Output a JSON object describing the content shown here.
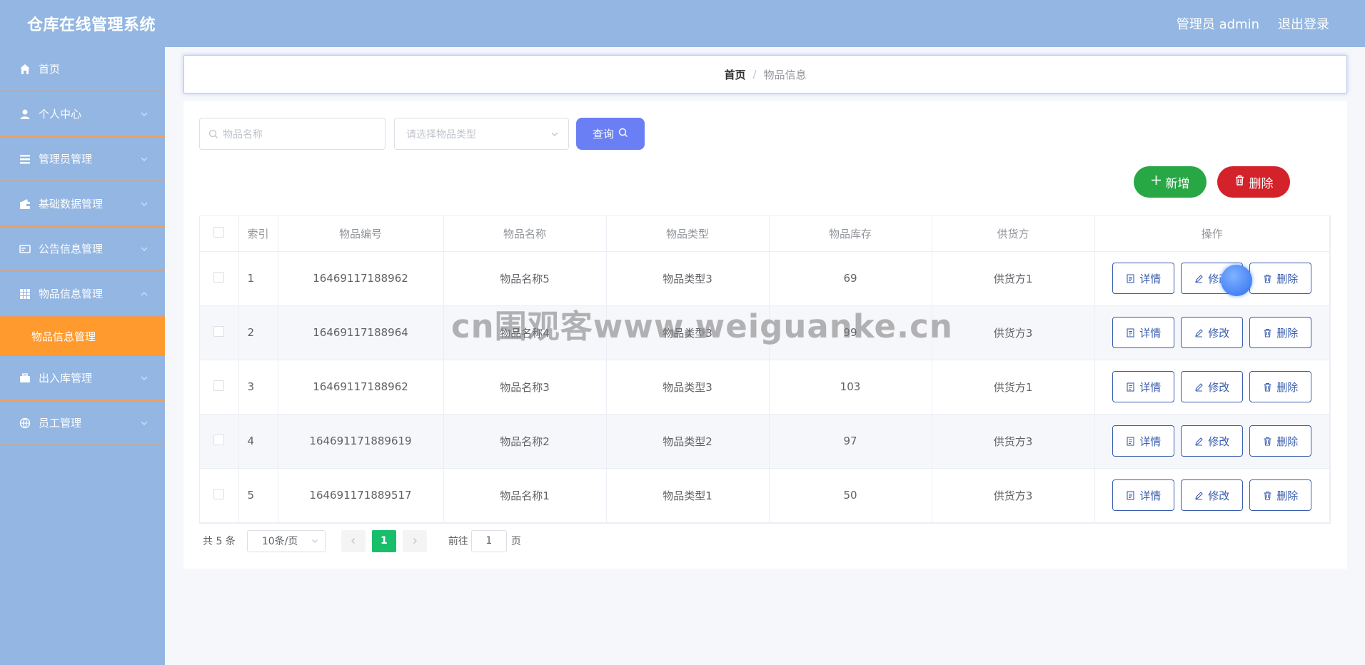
{
  "header": {
    "app_title": "仓库在线管理系统",
    "user_label": "管理员 admin",
    "logout_label": "退出登录"
  },
  "sidebar": {
    "items": [
      {
        "label": "首页",
        "icon": "home-icon"
      },
      {
        "label": "个人中心",
        "icon": "user-icon"
      },
      {
        "label": "管理员管理",
        "icon": "list-icon"
      },
      {
        "label": "基础数据管理",
        "icon": "wallet-icon"
      },
      {
        "label": "公告信息管理",
        "icon": "card-icon"
      },
      {
        "label": "物品信息管理",
        "icon": "grid-icon"
      },
      {
        "label": "出入库管理",
        "icon": "briefcase-icon"
      },
      {
        "label": "员工管理",
        "icon": "globe-icon"
      }
    ],
    "active_subitem": "物品信息管理"
  },
  "breadcrumb": {
    "home": "首页",
    "separator": "/",
    "current": "物品信息"
  },
  "search": {
    "name_placeholder": "物品名称",
    "type_placeholder": "请选择物品类型",
    "query_label": "查询"
  },
  "actions": {
    "add_label": "新增",
    "delete_label": "删除"
  },
  "table": {
    "headers": [
      "索引",
      "物品编号",
      "物品名称",
      "物品类型",
      "物品库存",
      "供货方",
      "操作"
    ],
    "op_labels": {
      "detail": "详情",
      "edit": "修改",
      "delete": "删除"
    },
    "rows": [
      {
        "index": "1",
        "code": "16469117188962",
        "name": "物品名称5",
        "type": "物品类型3",
        "stock": "69",
        "supplier": "供货方1"
      },
      {
        "index": "2",
        "code": "16469117188964",
        "name": "物品名称4",
        "type": "物品类型3",
        "stock": "99",
        "supplier": "供货方3"
      },
      {
        "index": "3",
        "code": "16469117188962",
        "name": "物品名称3",
        "type": "物品类型3",
        "stock": "103",
        "supplier": "供货方1"
      },
      {
        "index": "4",
        "code": "164691171889619",
        "name": "物品名称2",
        "type": "物品类型2",
        "stock": "97",
        "supplier": "供货方3"
      },
      {
        "index": "5",
        "code": "164691171889517",
        "name": "物品名称1",
        "type": "物品类型1",
        "stock": "50",
        "supplier": "供货方3"
      }
    ]
  },
  "pagination": {
    "total_text": "共 5 条",
    "page_size": "10条/页",
    "current_page": "1",
    "goto_label": "前往",
    "goto_value": "1",
    "page_suffix": "页"
  },
  "watermark": "cn围观客www.weiguanke.cn",
  "colors": {
    "header_bg": "#93b6e2",
    "sidebar_active": "#ff9a2e",
    "query_button": "#6b7ff5",
    "add_button": "#28a745",
    "delete_button": "#d3222a",
    "pager_active": "#19be6b"
  }
}
